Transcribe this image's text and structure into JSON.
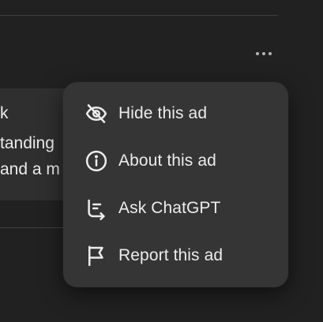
{
  "ad_card": {
    "lines": [
      "k",
      "tanding",
      "and a m"
    ]
  },
  "menu": {
    "items": [
      {
        "label": "Hide this ad",
        "icon": "eye-off-icon"
      },
      {
        "label": "About this ad",
        "icon": "info-icon"
      },
      {
        "label": "Ask ChatGPT",
        "icon": "chatgpt-ask-icon"
      },
      {
        "label": "Report this ad",
        "icon": "flag-icon"
      }
    ]
  },
  "colors": {
    "background": "#212121",
    "menu_background": "#353535",
    "text": "#ececec"
  }
}
